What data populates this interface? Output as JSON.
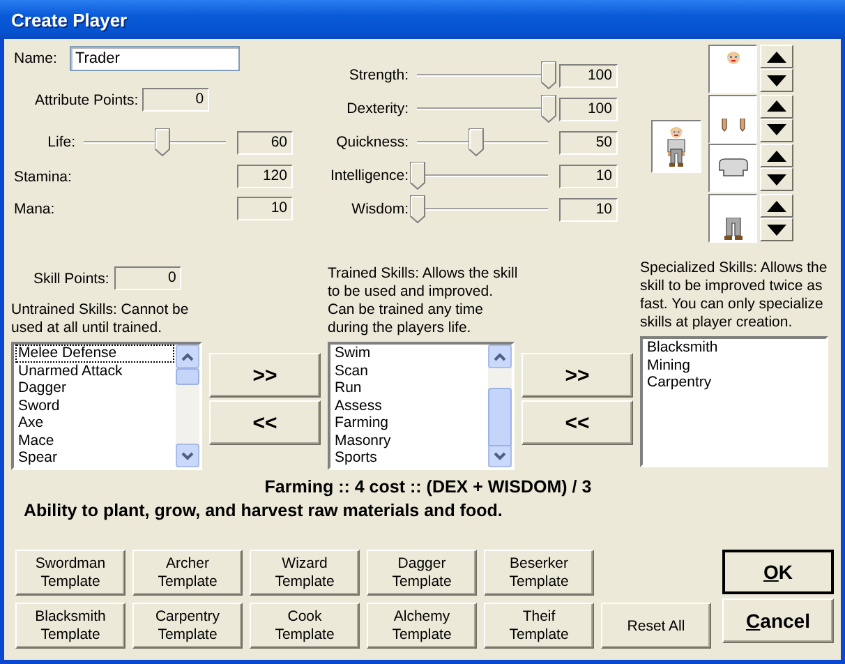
{
  "window": {
    "title": "Create Player"
  },
  "name_field": {
    "label": "Name:",
    "value": "Trader"
  },
  "attribute_points": {
    "label": "Attribute Points:",
    "value": "0"
  },
  "vitals": [
    {
      "label": "Life:",
      "kind": "slider",
      "level": 0.55,
      "value": "60"
    },
    {
      "label": "Stamina:",
      "kind": "readout",
      "value": "120"
    },
    {
      "label": "Mana:",
      "kind": "readout",
      "value": "10"
    }
  ],
  "attributes": [
    {
      "label": "Strength:",
      "level": 1,
      "value": "100"
    },
    {
      "label": "Dexterity:",
      "level": 1,
      "value": "100"
    },
    {
      "label": "Quickness:",
      "level": 0.45,
      "value": "50"
    },
    {
      "label": "Intelligence:",
      "level": 0,
      "value": "10"
    },
    {
      "label": "Wisdom:",
      "level": 0,
      "value": "10"
    }
  ],
  "appearance": {
    "parts": [
      {
        "kind": "head"
      },
      {
        "kind": "hands"
      },
      {
        "kind": "torso"
      },
      {
        "kind": "legs"
      }
    ]
  },
  "skill_points": {
    "label": "Skill Points:",
    "value": "0"
  },
  "untrained": {
    "caption": "Untrained Skills: Cannot be\nused at all until trained.",
    "items": [
      {
        "label": "Melee Defense",
        "focused": true
      },
      {
        "label": "Unarmed Attack",
        "focused": false
      },
      {
        "label": "Dagger",
        "focused": false
      },
      {
        "label": "Sword",
        "focused": false
      },
      {
        "label": "Axe",
        "focused": false
      },
      {
        "label": "Mace",
        "focused": false
      },
      {
        "label": "Spear",
        "focused": false
      }
    ]
  },
  "train_buttons": [
    ">>",
    "<<"
  ],
  "trained": {
    "caption": "Trained Skills: Allows the skill\nto be used and improved.\nCan be trained any time\nduring the players life.",
    "items": [
      {
        "label": "Swim",
        "focused": false
      },
      {
        "label": "Scan",
        "focused": false
      },
      {
        "label": "Run",
        "focused": false
      },
      {
        "label": "Assess",
        "focused": false
      },
      {
        "label": "Farming",
        "focused": false
      },
      {
        "label": "Masonry",
        "focused": false
      },
      {
        "label": "Sports",
        "focused": false
      }
    ]
  },
  "specialize_buttons": [
    ">>",
    "<<"
  ],
  "specialized": {
    "caption": "Specialized Skills: Allows the\nskill to be improved twice as\nfast. You can only specialize\nskills at player creation.",
    "items": [
      {
        "label": "Blacksmith",
        "focused": false
      },
      {
        "label": "Mining",
        "focused": false
      },
      {
        "label": "Carpentry",
        "focused": false
      }
    ]
  },
  "description": {
    "title": "Farming :: 4 cost :: (DEX + WISDOM) / 3",
    "text": "Ability to plant, grow, and harvest raw materials and food."
  },
  "templates": [
    "Swordman Template",
    "Archer Template",
    "Wizard Template",
    "Dagger Template",
    "Beserker Template",
    "Blacksmith Template",
    "Carpentry Template",
    "Cook Template",
    "Alchemy Template",
    "Theif Template"
  ],
  "reset_button": "Reset All",
  "dialog_buttons": [
    {
      "label": "OK",
      "default": true
    },
    {
      "label": "Cancel",
      "default": false
    }
  ]
}
